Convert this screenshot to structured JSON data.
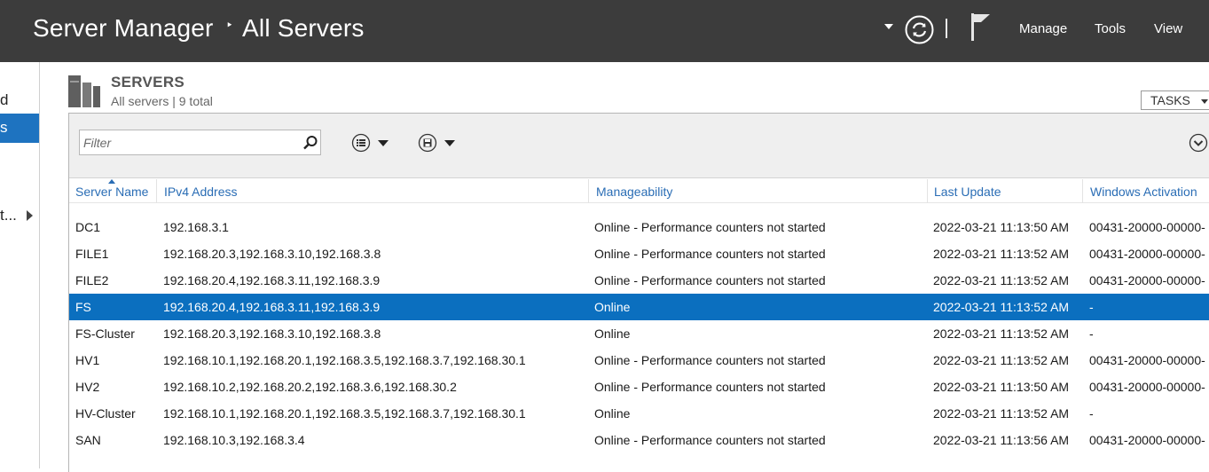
{
  "titlebar": {
    "app": "Server Manager",
    "separator": "‣",
    "page": "All Servers",
    "menu": [
      "Manage",
      "Tools",
      "View"
    ]
  },
  "sidebar": {
    "items": [
      "d",
      "s",
      "t..."
    ]
  },
  "section": {
    "title": "SERVERS",
    "subtitle": "All servers | 9 total",
    "tasks_label": "TASKS"
  },
  "filter": {
    "placeholder": "Filter"
  },
  "table": {
    "columns": [
      "Server Name",
      "IPv4 Address",
      "Manageability",
      "Last Update",
      "Windows Activation"
    ],
    "rows": [
      {
        "name": "DC1",
        "ipv4": "192.168.3.1",
        "manageability": "Online - Performance counters not started",
        "last_update": "2022-03-21 11:13:50 AM",
        "activation": "00431-20000-00000-"
      },
      {
        "name": "FILE1",
        "ipv4": "192.168.20.3,192.168.3.10,192.168.3.8",
        "manageability": "Online - Performance counters not started",
        "last_update": "2022-03-21 11:13:52 AM",
        "activation": "00431-20000-00000-"
      },
      {
        "name": "FILE2",
        "ipv4": "192.168.20.4,192.168.3.11,192.168.3.9",
        "manageability": "Online - Performance counters not started",
        "last_update": "2022-03-21 11:13:52 AM",
        "activation": "00431-20000-00000-"
      },
      {
        "name": "FS",
        "ipv4": "192.168.20.4,192.168.3.11,192.168.3.9",
        "manageability": "Online",
        "last_update": "2022-03-21 11:13:52 AM",
        "activation": "-"
      },
      {
        "name": "FS-Cluster",
        "ipv4": "192.168.20.3,192.168.3.10,192.168.3.8",
        "manageability": "Online",
        "last_update": "2022-03-21 11:13:52 AM",
        "activation": "-"
      },
      {
        "name": "HV1",
        "ipv4": "192.168.10.1,192.168.20.1,192.168.3.5,192.168.3.7,192.168.30.1",
        "manageability": "Online - Performance counters not started",
        "last_update": "2022-03-21 11:13:52 AM",
        "activation": "00431-20000-00000-"
      },
      {
        "name": "HV2",
        "ipv4": "192.168.10.2,192.168.20.2,192.168.3.6,192.168.30.2",
        "manageability": "Online - Performance counters not started",
        "last_update": "2022-03-21 11:13:50 AM",
        "activation": "00431-20000-00000-"
      },
      {
        "name": "HV-Cluster",
        "ipv4": "192.168.10.1,192.168.20.1,192.168.3.5,192.168.3.7,192.168.30.1",
        "manageability": "Online",
        "last_update": "2022-03-21 11:13:52 AM",
        "activation": "-"
      },
      {
        "name": "SAN",
        "ipv4": "192.168.10.3,192.168.3.4",
        "manageability": "Online - Performance counters not started",
        "last_update": "2022-03-21 11:13:56 AM",
        "activation": "00431-20000-00000-"
      }
    ],
    "selected_row": "FS"
  },
  "colors": {
    "titlebar": "#3c3c3c",
    "accent": "#1e73c0",
    "selection": "#0b6fbf",
    "header_text": "#2a6db5"
  },
  "icons": [
    "refresh-icon",
    "flag-icon",
    "servers-icon",
    "search-icon",
    "list-view-icon",
    "save-icon",
    "expand-icon"
  ]
}
